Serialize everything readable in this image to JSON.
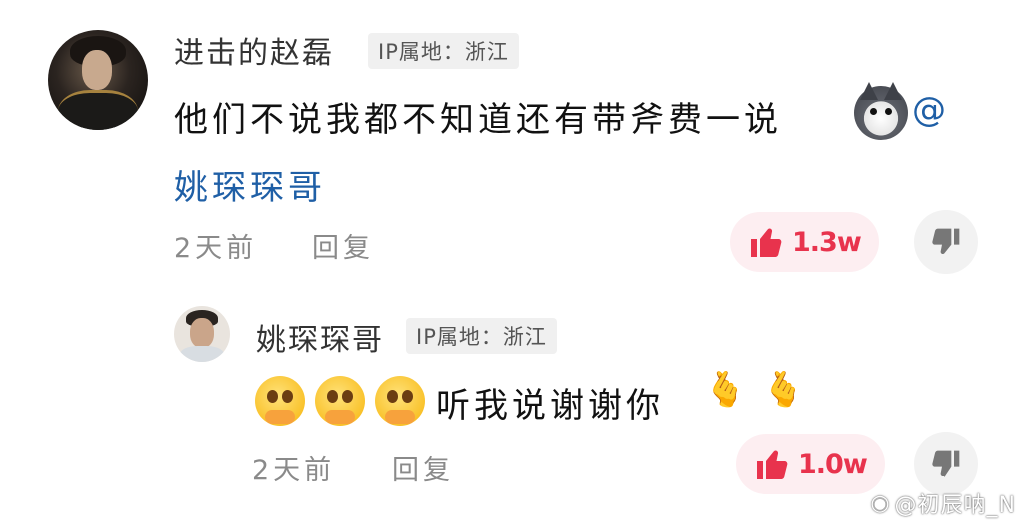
{
  "comment": {
    "username": "进击的赵磊",
    "ip": "IP属地：浙江",
    "text": "他们不说我都不知道还有带斧费一说",
    "at_symbol": "@",
    "mention": "姚琛琛哥",
    "time": "2天前",
    "reply_label": "回复",
    "like_count": "1.3w"
  },
  "reply": {
    "username": "姚琛琛哥",
    "ip": "IP属地：浙江",
    "text": "听我说谢谢你",
    "time": "2天前",
    "reply_label": "回复",
    "like_count": "1.0w"
  },
  "watermark": "@初辰呐_N",
  "colors": {
    "like": "#e8334d",
    "like_bg": "#fdeef1",
    "mention": "#1f5fa6",
    "muted": "#8a8a8a"
  }
}
